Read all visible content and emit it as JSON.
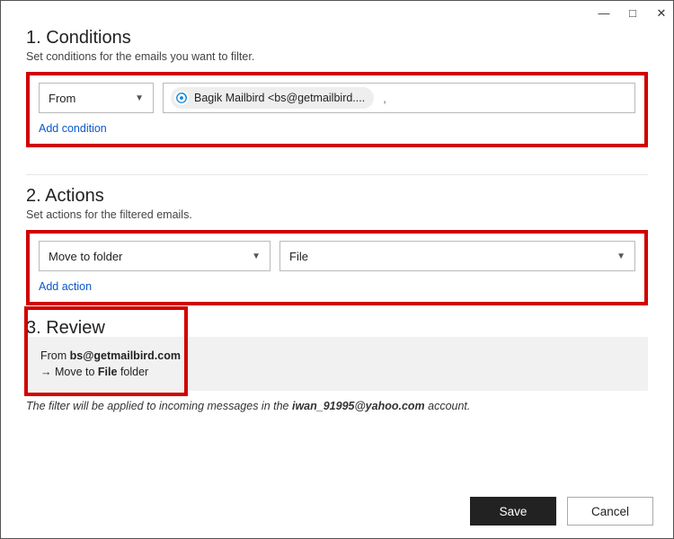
{
  "window": {
    "minimize_glyph": "—",
    "maximize_glyph": "□",
    "close_glyph": "✕"
  },
  "conditions": {
    "title": "1. Conditions",
    "subtitle": "Set conditions for the emails you want to filter.",
    "field_label": "From",
    "chip_text": "Bagik Mailbird  <bs@getmailbird....",
    "trailing_comma": ",",
    "add_link": "Add condition"
  },
  "actions": {
    "title": "2. Actions",
    "subtitle": "Set actions for the filtered emails.",
    "action_label": "Move to folder",
    "folder_label": "File",
    "add_link": "Add action"
  },
  "review": {
    "title": "3. Review",
    "line1_prefix": "From ",
    "line1_bold": "bs@getmailbird.com",
    "line2_prefix": "→  Move to ",
    "line2_bold": "File",
    "line2_suffix": " folder"
  },
  "note": {
    "prefix": "The filter will be applied to incoming messages in the ",
    "account": "iwan_91995@yahoo.com",
    "suffix": " account."
  },
  "buttons": {
    "save": "Save",
    "cancel": "Cancel"
  }
}
